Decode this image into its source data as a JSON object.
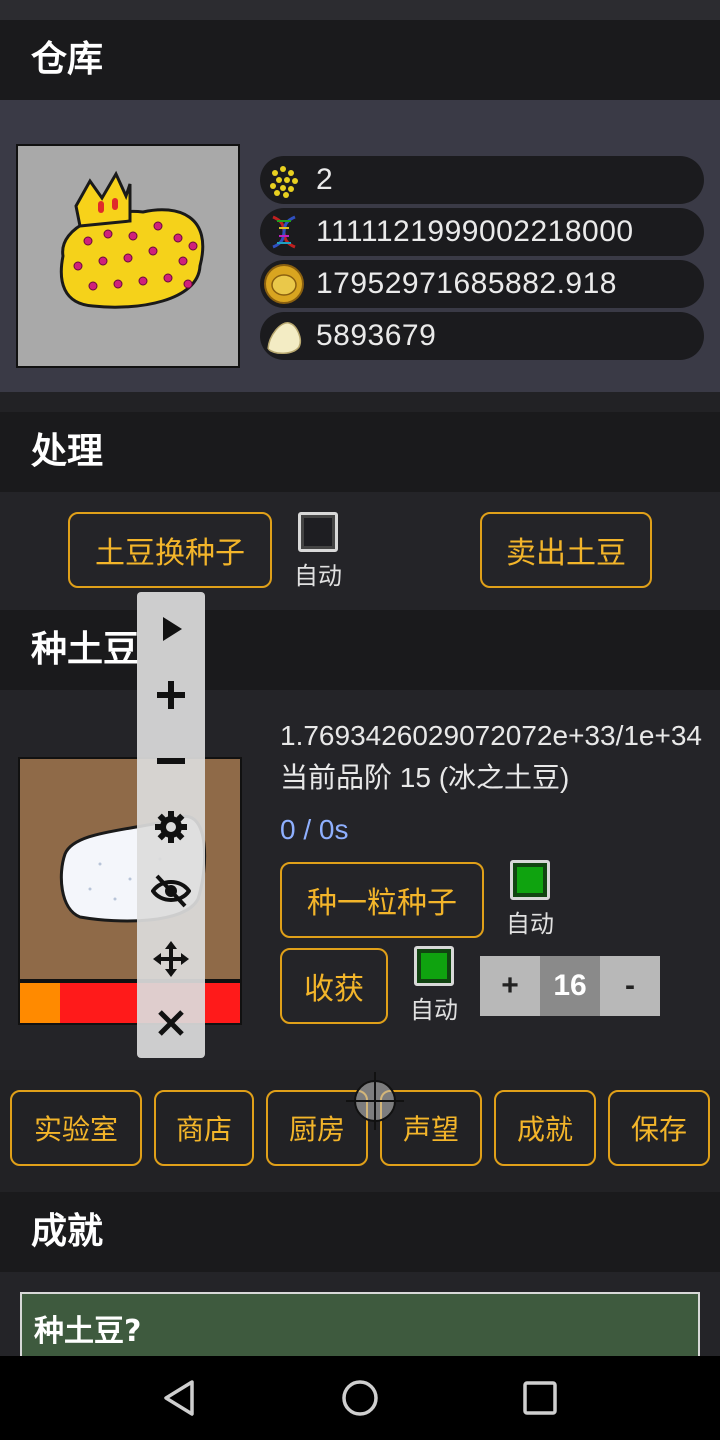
{
  "sections": {
    "warehouse_title": "仓库",
    "process_title": "处理",
    "plant_title": "种土豆",
    "achievement_title": "成就"
  },
  "warehouse": {
    "resources": [
      {
        "icon": "seeds-icon",
        "value": "2"
      },
      {
        "icon": "dna-icon",
        "value": "1111121999002218000"
      },
      {
        "icon": "potato-coin-icon",
        "value": "17952971685882.918"
      },
      {
        "icon": "potato-chip-icon",
        "value": "5893679"
      }
    ]
  },
  "process": {
    "exchange_button": "土豆换种子",
    "auto_label": "自动",
    "auto_checked": false,
    "sell_button": "卖出土豆"
  },
  "plant": {
    "progress_text": "1.7693426029072072e+33/1e+34",
    "grade_text": "当前品阶 15 (冰之土豆)",
    "timer_text": "0 / 0s",
    "plant_button": "种一粒种子",
    "plant_auto_label": "自动",
    "plant_auto_checked": true,
    "harvest_button": "收获",
    "harvest_auto_label": "自动",
    "harvest_auto_checked": true,
    "stepper": {
      "plus": "+",
      "value": "16",
      "minus": "-"
    },
    "growth_fraction": 0.18
  },
  "nav_buttons": [
    {
      "label": "实验室",
      "name": "lab-button"
    },
    {
      "label": "商店",
      "name": "shop-button"
    },
    {
      "label": "厨房",
      "name": "kitchen-button"
    },
    {
      "label": "声望",
      "name": "prestige-button"
    },
    {
      "label": "成就",
      "name": "achievements-button"
    },
    {
      "label": "保存",
      "name": "save-button"
    }
  ],
  "achievements": {
    "first_card": "种土豆?"
  },
  "floating_toolbar": [
    "play-icon",
    "zoom-in-icon",
    "zoom-out-icon",
    "settings-icon",
    "hide-icon",
    "move-icon",
    "close-icon"
  ],
  "colors": {
    "accent": "#f3b52a",
    "checkbox_on": "#0fa30f",
    "timer": "#8fb0ff",
    "progress_orange": "#ff8a00",
    "progress_red": "#ff1a1a"
  }
}
